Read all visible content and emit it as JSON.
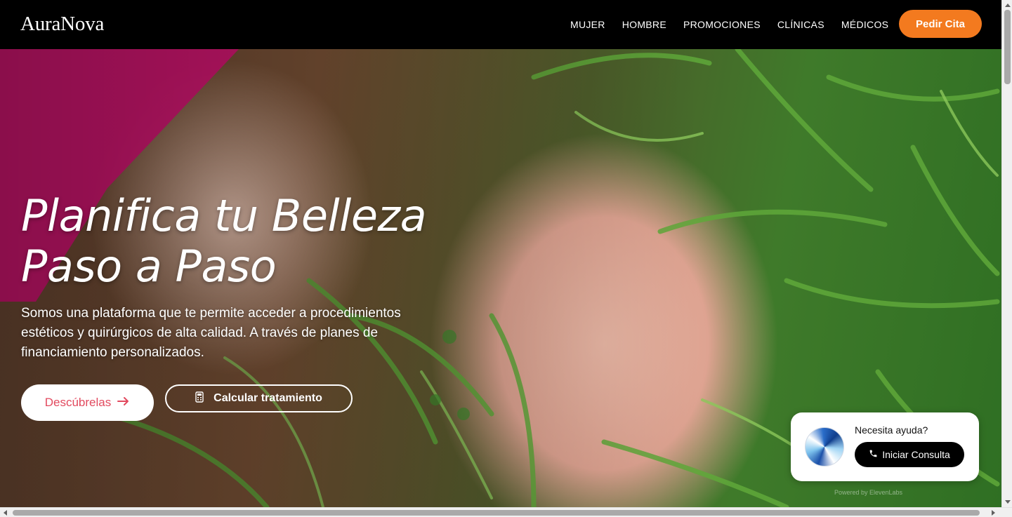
{
  "header": {
    "logo": "AuraNova",
    "nav": [
      "MUJER",
      "HOMBRE",
      "PROMOCIONES",
      "CLÍNICAS",
      "MÉDICOS"
    ],
    "cta_label": "Pedir Cita",
    "cta_color": "#f37a1f"
  },
  "hero": {
    "title_line1": "Planifica tu Belleza",
    "title_line2": "Paso a Paso",
    "description": "Somos una plataforma que te permite acceder a procedimientos estéticos y quirúrgicos de alta calidad. A través de planes de financiamiento personalizados.",
    "primary_button": "Descúbrelas",
    "primary_button_icon": "arrow-right-icon",
    "primary_text_color": "#e24a5f",
    "secondary_button": "Calcular tratamiento",
    "secondary_button_icon": "calculator-icon"
  },
  "widget": {
    "prompt": "Necesita ayuda?",
    "button_label": "Iniciar Consulta",
    "button_icon": "phone-icon",
    "footer": "Powered by ElevenLabs"
  }
}
